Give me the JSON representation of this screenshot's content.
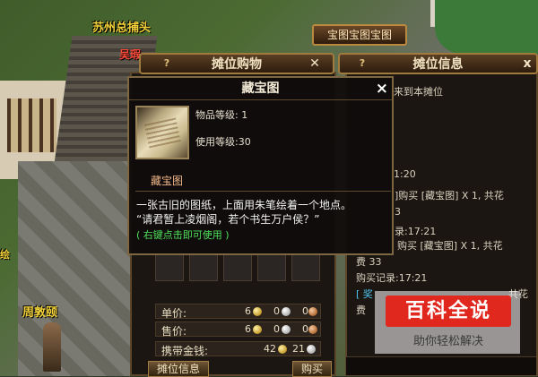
{
  "npcs": {
    "suzhou_catcher": "苏州总捕头",
    "npc_partial": "吴瑕",
    "zhou_dunyi": "周敦颐",
    "left_edge": "绘"
  },
  "top_button": "宝图宝图宝图",
  "stall_panel": {
    "title": "摊位购物",
    "help": "?",
    "close": "✕",
    "price_rows": [
      {
        "label": "单价:",
        "gold": "6",
        "silver": "0",
        "copper": "0"
      },
      {
        "label": "售价:",
        "gold": "6",
        "silver": "0",
        "copper": "0"
      },
      {
        "label": "携带金钱:",
        "gold": "42",
        "silver": "21"
      }
    ],
    "footer_tab": "摊位信息",
    "buy_button": "购买"
  },
  "info_panel": {
    "title": "摊位信息",
    "help": "?",
    "close": "x",
    "lines": [
      {
        "text": "来到本摊位"
      },
      {
        "text": "1:20"
      },
      {
        "text": "]购买 [藏宝图] X 1, 共花"
      },
      {
        "text": "3"
      },
      {
        "text": "录:17:21"
      },
      {
        "text": "购买 [藏宝图] X 1, 共花"
      },
      {
        "text": "费 33"
      },
      {
        "text": "购买记录:17:21"
      },
      {
        "text": "[ 奖"
      },
      {
        "text": "共花"
      },
      {
        "text": "费"
      }
    ]
  },
  "tooltip": {
    "title": "藏宝图",
    "close": "×",
    "item_level": "物品等级: 1",
    "use_level": "使用等级:30",
    "name": "藏宝图",
    "desc_line1": "一张古旧的图纸，上面用朱笔绘着一个地点。",
    "desc_line2": "“请君暂上凌烟阁，若个书生万户侯？”",
    "hint": "( 右键点击即可使用 )"
  },
  "watermark": {
    "main": "百科全说",
    "sub": "助你轻松解决"
  },
  "colors": {
    "panel_border": "#5c4629",
    "gold_text": "#f3d23a",
    "hint_green": "#4fe05a",
    "watermark_red": "#e1281e"
  }
}
